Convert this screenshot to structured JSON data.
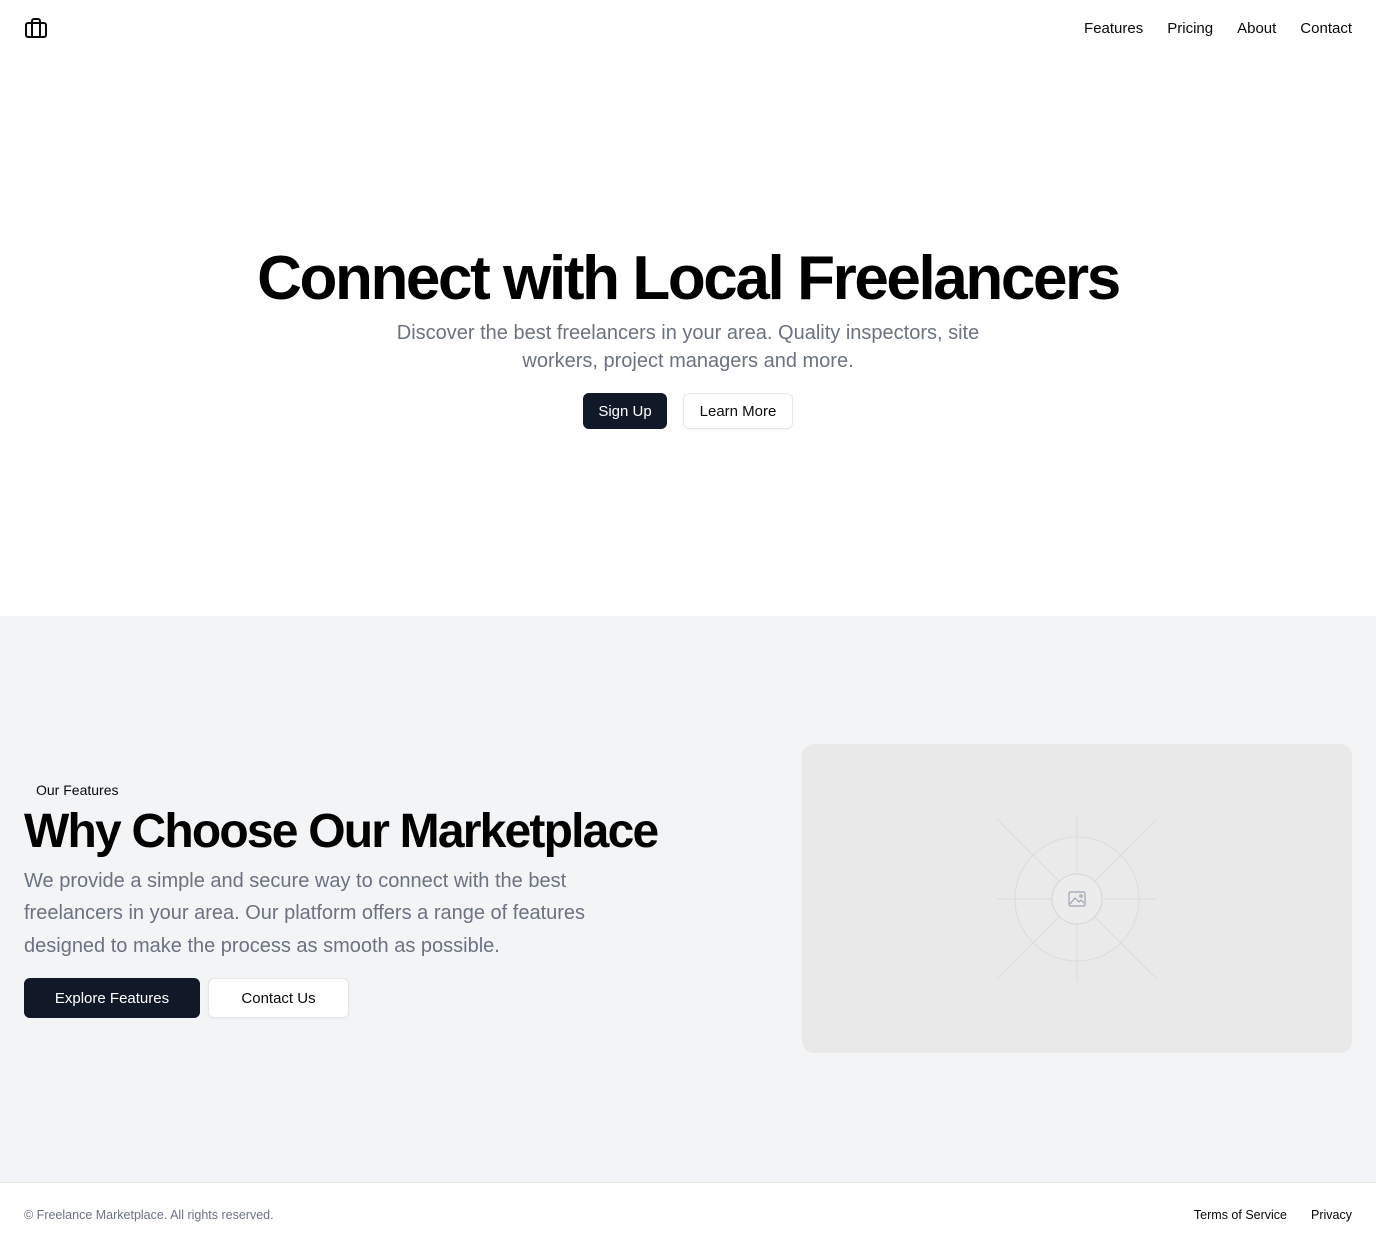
{
  "header": {
    "logo_icon": "briefcase-icon",
    "nav": [
      {
        "label": "Features"
      },
      {
        "label": "Pricing"
      },
      {
        "label": "About"
      },
      {
        "label": "Contact"
      }
    ]
  },
  "hero": {
    "title": "Connect with Local Freelancers",
    "subtitle": "Discover the best freelancers in your area. Quality inspectors, site workers, project managers and more.",
    "primary_label": "Sign Up",
    "secondary_label": "Learn More"
  },
  "features": {
    "badge": "Our Features",
    "title": "Why Choose Our Marketplace",
    "description": "We provide a simple and secure way to connect with the best freelancers in your area. Our platform offers a range of features designed to make the process as smooth as possible.",
    "primary_label": "Explore Features",
    "secondary_label": "Contact Us",
    "image_icon": "image-placeholder-icon"
  },
  "footer": {
    "copyright": "© Freelance Marketplace. All rights reserved.",
    "links": [
      {
        "label": "Terms of Service"
      },
      {
        "label": "Privacy"
      }
    ]
  },
  "colors": {
    "primary": "#111827",
    "muted_text": "#6b7280",
    "section_bg": "#f2f4f6",
    "placeholder_bg": "#e9e9e9"
  }
}
